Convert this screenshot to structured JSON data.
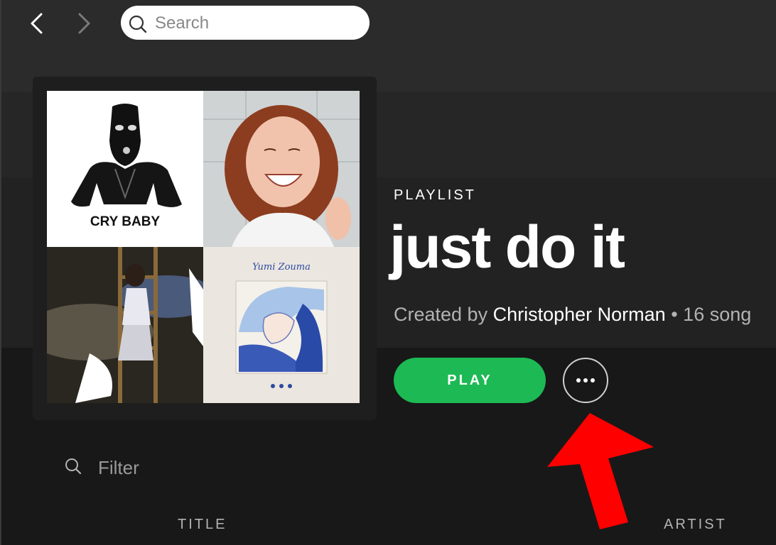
{
  "search": {
    "placeholder": "Search"
  },
  "playlist": {
    "type_label": "PLAYLIST",
    "title": "just do it",
    "created_by_prefix": "Created by",
    "owner": "Christopher Norman",
    "separator": "•",
    "song_count": "16 song"
  },
  "actions": {
    "play_label": "PLAY"
  },
  "filter": {
    "placeholder": "Filter"
  },
  "columns": {
    "title": "TITLE",
    "artist": "ARTIST"
  },
  "cover_tiles": [
    {
      "icon": "album-cover-1",
      "text": "CRY BABY"
    },
    {
      "icon": "album-cover-2"
    },
    {
      "icon": "album-cover-3"
    },
    {
      "icon": "album-cover-4",
      "text": "Yumi Zouma"
    }
  ],
  "colors": {
    "accent": "#1db954",
    "annotation_arrow": "#ff0000"
  }
}
